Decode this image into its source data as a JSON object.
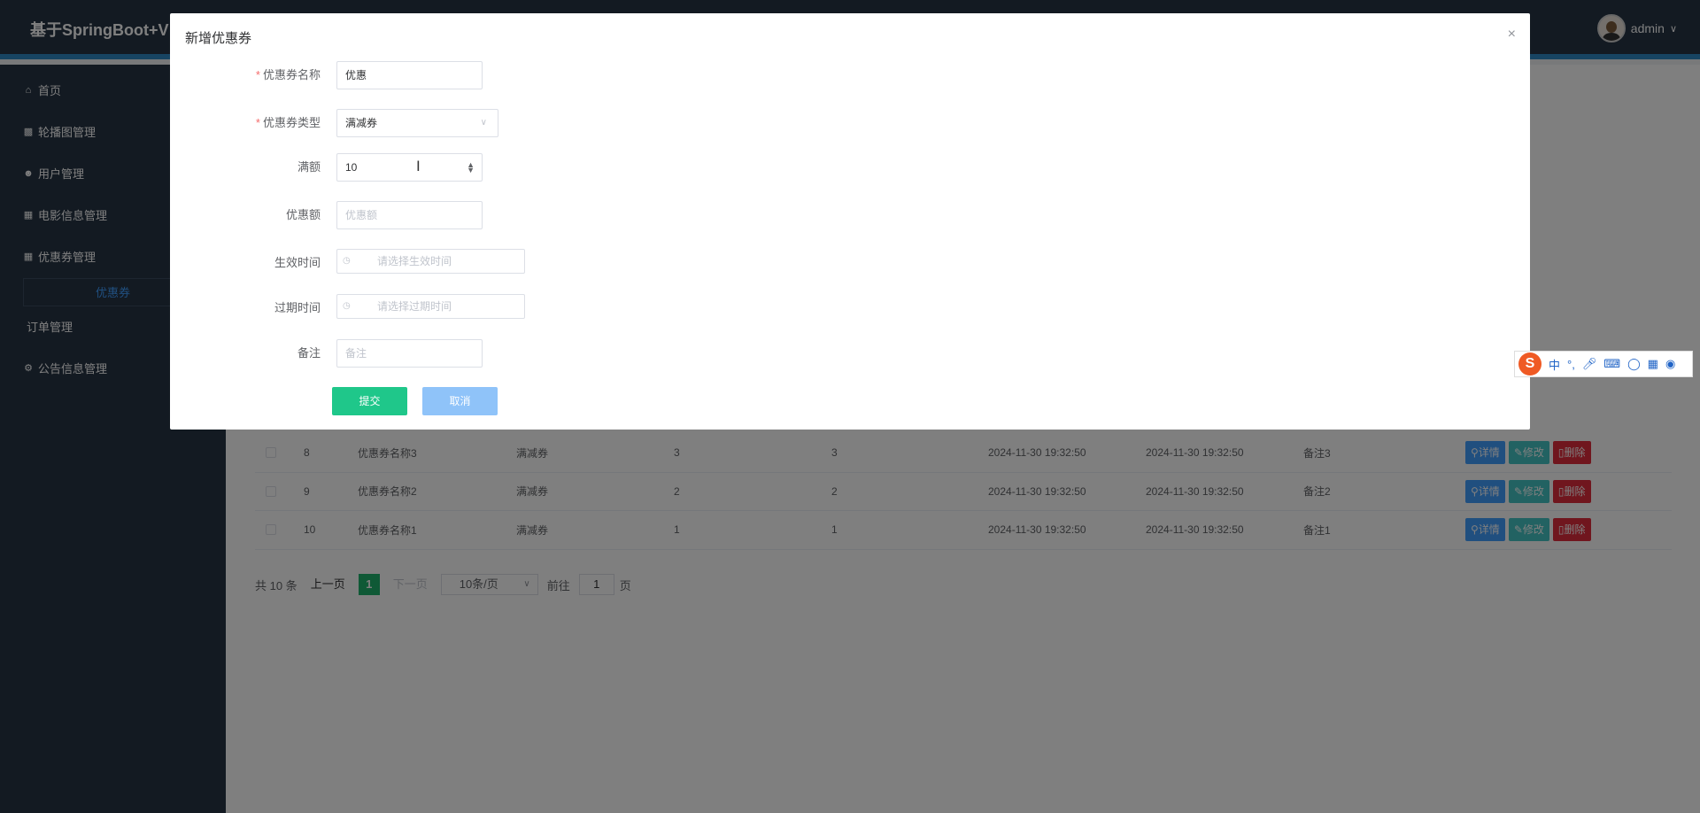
{
  "header": {
    "app_title": "基于SpringBoot+V",
    "user_name": "admin",
    "user_menu_icon": "chevron-down-icon"
  },
  "sidebar": {
    "items": [
      {
        "label": "首页",
        "icon": "home-icon"
      },
      {
        "label": "轮播图管理",
        "icon": "chart-icon"
      },
      {
        "label": "用户管理",
        "icon": "user-icon"
      },
      {
        "label": "电影信息管理",
        "icon": "grid-icon"
      },
      {
        "label": "优惠券管理",
        "icon": "grid-icon"
      },
      {
        "label": "订单管理",
        "icon": ""
      },
      {
        "label": "公告信息管理",
        "icon": "gear-icon"
      }
    ],
    "active_sub": "优惠券"
  },
  "table": {
    "rows": [
      {
        "id": "8",
        "name": "优惠券名称3",
        "type": "满减券",
        "full": "3",
        "discount": "3",
        "start": "2024-11-30 19:32:50",
        "end": "2024-11-30 19:32:50",
        "remark": "备注3"
      },
      {
        "id": "9",
        "name": "优惠券名称2",
        "type": "满减券",
        "full": "2",
        "discount": "2",
        "start": "2024-11-30 19:32:50",
        "end": "2024-11-30 19:32:50",
        "remark": "备注2"
      },
      {
        "id": "10",
        "name": "优惠券名称1",
        "type": "满减券",
        "full": "1",
        "discount": "1",
        "start": "2024-11-30 19:32:50",
        "end": "2024-11-30 19:32:50",
        "remark": "备注1"
      }
    ],
    "actions": {
      "detail": "详情",
      "edit": "修改",
      "delete": "删除"
    }
  },
  "pagination": {
    "total": "共 10 条",
    "prev": "上一页",
    "current": "1",
    "next": "下一页",
    "page_size": "10条/页",
    "goto_label": "前往",
    "goto_value": "1",
    "page_suffix": "页"
  },
  "dialog": {
    "title": "新增优惠券",
    "close": "×",
    "fields": {
      "name": {
        "label": "优惠券名称",
        "value": "优惠"
      },
      "type": {
        "label": "优惠券类型",
        "value": "满减券"
      },
      "full": {
        "label": "满额",
        "value": "10"
      },
      "discount": {
        "label": "优惠额",
        "placeholder": "优惠额"
      },
      "start": {
        "label": "生效时间",
        "placeholder": "请选择生效时间"
      },
      "end": {
        "label": "过期时间",
        "placeholder": "请选择过期时间"
      },
      "remark": {
        "label": "备注",
        "placeholder": "备注"
      }
    },
    "submit": "提交",
    "cancel": "取消"
  },
  "ime": {
    "logo": "S",
    "mode": "中"
  }
}
